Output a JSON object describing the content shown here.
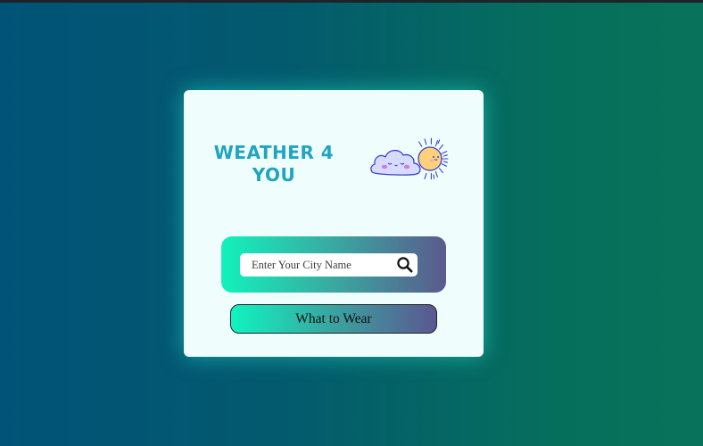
{
  "app": {
    "title_line1": "WEATHER 4",
    "title_line2": "YOU"
  },
  "search": {
    "placeholder": "Enter Your City Name",
    "value": "",
    "icon": "search-icon"
  },
  "actions": {
    "wear_label": "What to Wear"
  },
  "colors": {
    "background_start": "#025378",
    "background_end": "#08735a",
    "card": "#effdfc",
    "title": "#1fa4c2",
    "gradient_start": "#12f2bd",
    "gradient_end": "#5a5a8d"
  },
  "illustration": {
    "icon": "cloud-and-sun-icon"
  }
}
